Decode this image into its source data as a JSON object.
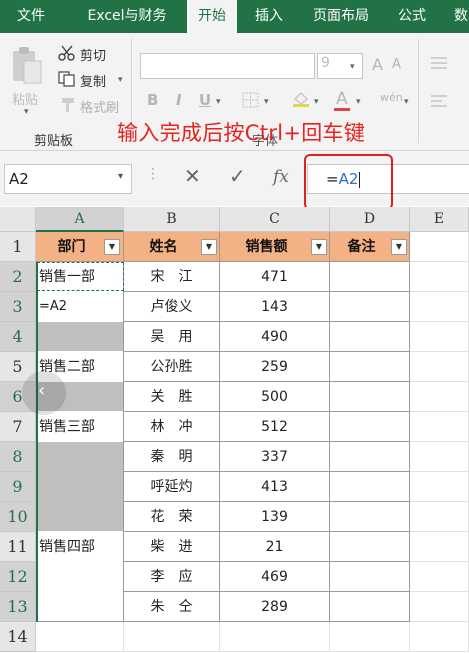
{
  "ribbon": {
    "tabs": [
      "文件",
      "Excel与财务",
      "开始",
      "插入",
      "页面布局",
      "公式",
      "数"
    ],
    "active_tab": "开始",
    "clipboard": {
      "paste": "粘贴",
      "cut": "剪切",
      "copy": "复制",
      "format_painter": "格式刷",
      "group_label": "剪贴板"
    },
    "font": {
      "size": "9",
      "grow": "A",
      "shrink": "A",
      "bold": "B",
      "italic": "I",
      "underline": "U",
      "group_label": "字体"
    }
  },
  "annotation": "输入完成后按Ctrl+回车键",
  "formula_bar": {
    "name_box": "A2",
    "cancel": "✕",
    "enter": "✓",
    "fx": "fx",
    "formula_prefix": "=",
    "formula_ref": "A2"
  },
  "columns": [
    "A",
    "B",
    "C",
    "D",
    "E"
  ],
  "rows": [
    "1",
    "2",
    "3",
    "4",
    "5",
    "6",
    "7",
    "8",
    "9",
    "10",
    "11",
    "12",
    "13",
    "14"
  ],
  "table": {
    "headers": [
      "部门",
      "姓名",
      "销售额",
      "备注"
    ],
    "dept": {
      "r2": "销售一部",
      "r3": "=A2",
      "r5": "销售二部",
      "r7": "销售三部",
      "r11": "销售四部"
    },
    "names": [
      "宋　江",
      "卢俊义",
      "吴　用",
      "公孙胜",
      "关　胜",
      "林　冲",
      "秦　明",
      "呼延灼",
      "花　荣",
      "柴　进",
      "李　应",
      "朱　仝"
    ],
    "sales": [
      "471",
      "143",
      "490",
      "259",
      "500",
      "512",
      "337",
      "413",
      "139",
      "21",
      "469",
      "289"
    ]
  },
  "colors": {
    "ribbon_green": "#217346",
    "header_fill": "#f4b183",
    "annotation_red": "#e8231f",
    "blank_fill": "#bfbfbf"
  }
}
